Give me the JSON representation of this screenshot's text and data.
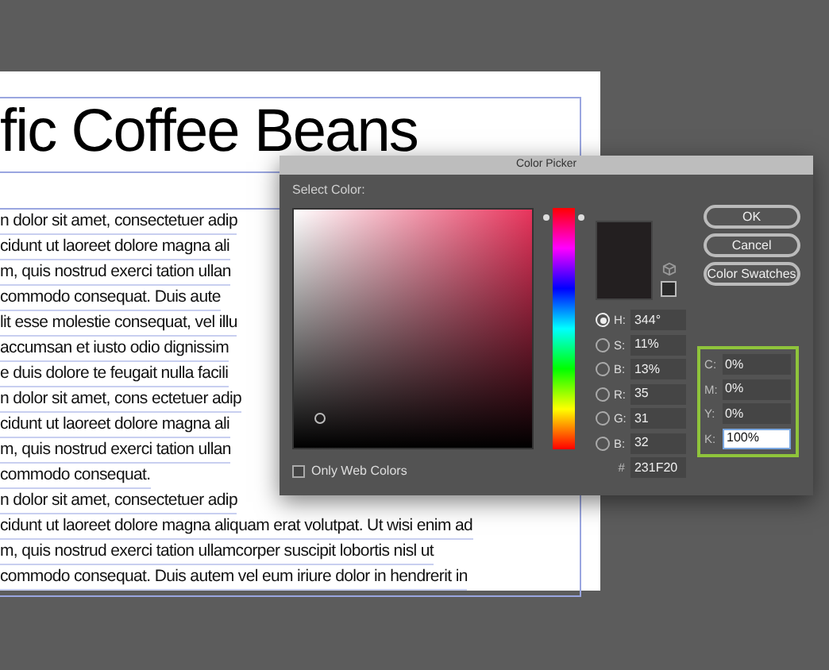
{
  "document": {
    "title": "fic Coffee Beans",
    "lines": [
      "n dolor sit amet, consectetuer adip",
      "cidunt ut laoreet dolore magna ali",
      "m, quis nostrud exerci tation ullan",
      "commodo consequat. Duis aute",
      "lit esse molestie consequat, vel illu",
      "accumsan et iusto odio dignissim",
      "e duis dolore te feugait nulla facili",
      "n dolor sit amet, cons ectetuer adip",
      "cidunt ut laoreet dolore magna ali",
      "m, quis nostrud exerci tation ullan",
      "commodo consequat.",
      "n dolor sit amet, consectetuer adip",
      "cidunt ut laoreet dolore magna aliquam erat volutpat. Ut wisi enim ad",
      "m, quis nostrud exerci tation ullamcorper suscipit lobortis nisl ut",
      "commodo consequat. Duis autem vel eum iriure dolor in hendrerit in"
    ]
  },
  "dialog": {
    "title": "Color Picker",
    "label": "Select Color:",
    "hue_slider": {
      "level": 0.96
    },
    "only_web_colors": {
      "label": "Only Web Colors",
      "checked": false
    },
    "buttons": [
      "OK",
      "Cancel",
      "Color Swatches"
    ],
    "fields": [
      {
        "label": "H:",
        "value": "344°",
        "selected": true
      },
      {
        "label": "S:",
        "value": "11%",
        "selected": false
      },
      {
        "label": "B:",
        "value": "13%",
        "selected": false
      },
      {
        "label": "R:",
        "value": "35",
        "selected": false
      },
      {
        "label": "G:",
        "value": "31",
        "selected": false
      },
      {
        "label": "B:",
        "value": "32",
        "selected": false
      }
    ],
    "hex_field": {
      "label": "#",
      "value": "231F20"
    },
    "cmyk_fields": [
      {
        "label": "C:",
        "value": "0%",
        "focused": false
      },
      {
        "label": "M:",
        "value": "0%",
        "focused": false
      },
      {
        "label": "Y:",
        "value": "0%",
        "focused": false
      },
      {
        "label": "K:",
        "value": "100%",
        "focused": true
      }
    ]
  }
}
